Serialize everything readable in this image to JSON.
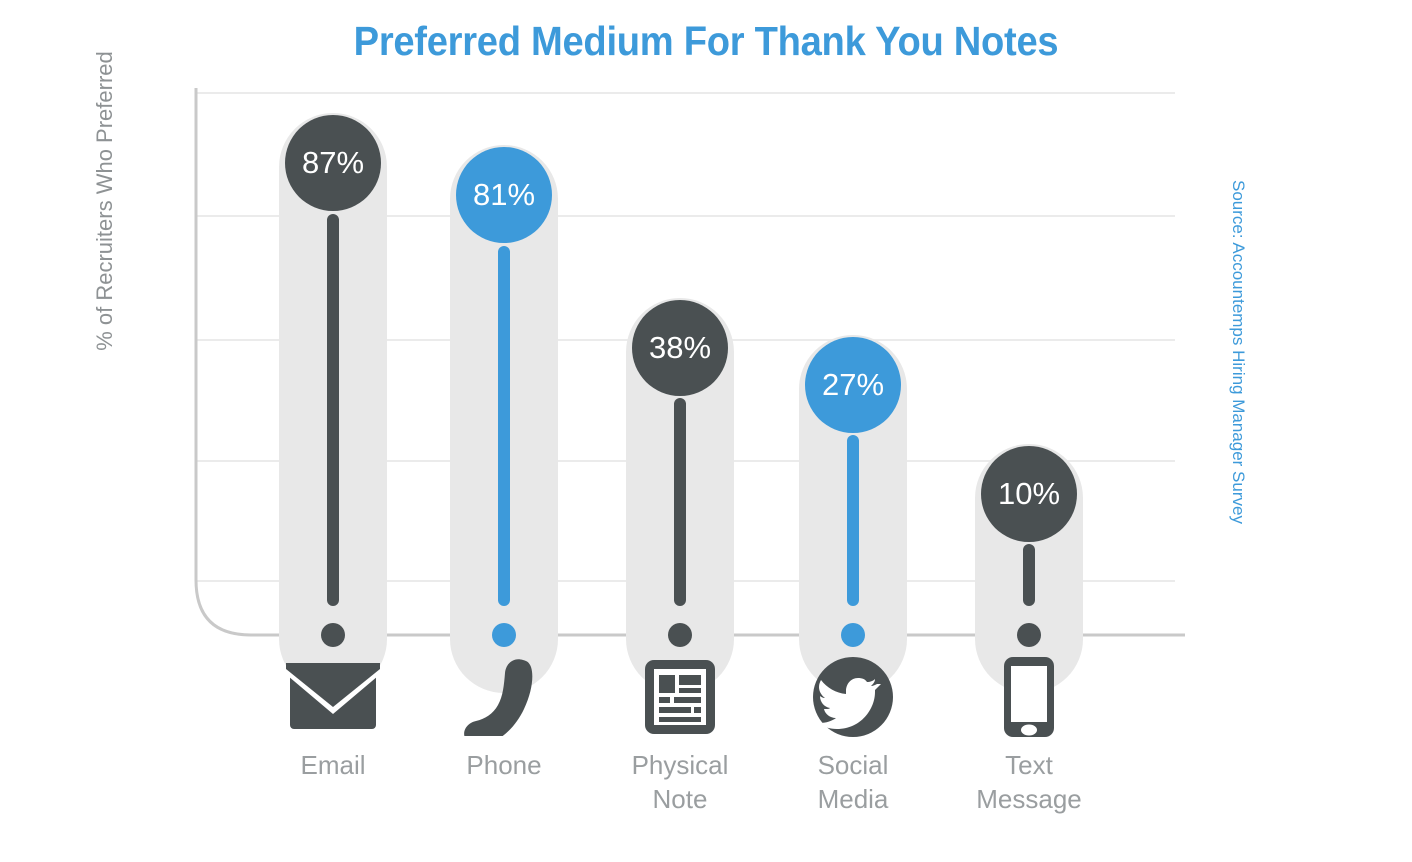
{
  "chart_data": {
    "type": "bar",
    "title": "Preferred Medium For Thank You Notes",
    "xlabel": "",
    "ylabel": "% of Recruiters Who Preferred",
    "ylim": [
      0,
      100
    ],
    "grid": true,
    "legend": "none",
    "source": "Source: Accountemps Hiring Manager Survey",
    "categories": [
      "Email",
      "Phone",
      "Physical Note",
      "Social Media",
      "Text Message"
    ],
    "values": [
      87,
      81,
      38,
      27,
      10
    ],
    "value_labels": [
      "87%",
      "81%",
      "38%",
      "27%",
      "10%"
    ],
    "series": [
      {
        "name": "% of Recruiters Who Preferred",
        "values": [
          87,
          81,
          38,
          27,
          10
        ]
      }
    ],
    "points": [
      {
        "category": "Email",
        "value": 87,
        "label": "87%",
        "color": "#4a5052",
        "icon": "envelope-icon",
        "label_lines": [
          "Email"
        ]
      },
      {
        "category": "Phone",
        "value": 81,
        "label": "81%",
        "color": "#3d9ada",
        "icon": "phone-icon",
        "label_lines": [
          "Phone"
        ]
      },
      {
        "category": "Physical Note",
        "value": 38,
        "label": "38%",
        "color": "#4a5052",
        "icon": "document-icon",
        "label_lines": [
          "Physical",
          "Note"
        ]
      },
      {
        "category": "Social Media",
        "value": 27,
        "label": "27%",
        "color": "#3d9ada",
        "icon": "twitter-icon",
        "label_lines": [
          "Social",
          "Media"
        ]
      },
      {
        "category": "Text Message",
        "value": 10,
        "label": "10%",
        "color": "#4a5052",
        "icon": "smartphone-icon",
        "label_lines": [
          "Text",
          "Message"
        ]
      }
    ],
    "gridline_count": 5
  },
  "colors": {
    "title_blue": "#3d9ada",
    "accent_blue": "#3d9ada",
    "dark_slate": "#4a5052",
    "track_gray": "#e8e8e8",
    "gridline_gray": "#ebebeb",
    "axis_gray": "#c9c9c9",
    "label_gray": "#9a9ea0",
    "axis_title_gray": "#8e9294",
    "background": "#ffffff"
  },
  "labels": {
    "bar_0_value": "87%",
    "bar_1_value": "81%",
    "bar_2_value": "38%",
    "bar_3_value": "27%",
    "bar_4_value": "10%",
    "cat_0_line_0": "Email",
    "cat_1_line_0": "Phone",
    "cat_2_line_0": "Physical",
    "cat_2_line_1": "Note",
    "cat_3_line_0": "Social",
    "cat_3_line_1": "Media",
    "cat_4_line_0": "Text",
    "cat_4_line_1": "Message"
  }
}
